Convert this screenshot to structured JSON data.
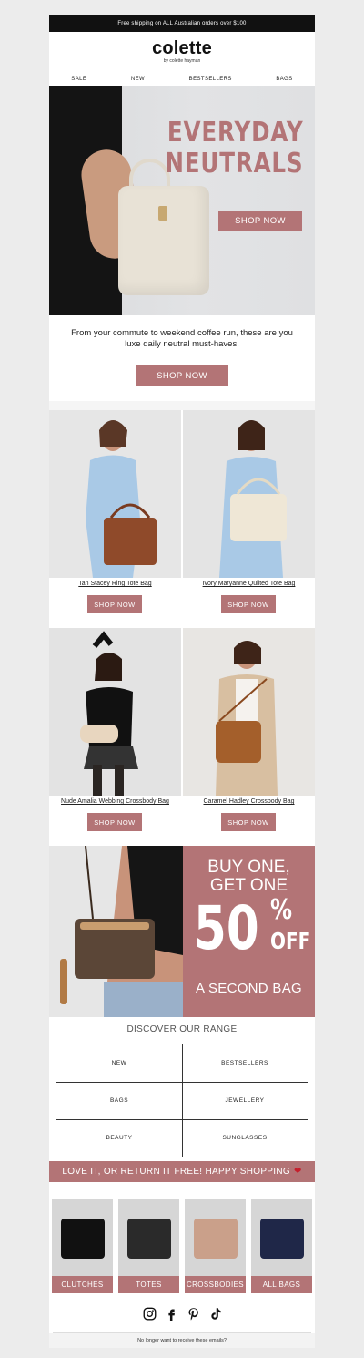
{
  "topbar": {
    "text": "Free shipping on ALL Australian orders over $100"
  },
  "brand": {
    "logo": "colette",
    "sub": "by colette hayman",
    "accent": "#b37476"
  },
  "nav": {
    "items": [
      "SALE",
      "NEW",
      "BESTSELLERS",
      "BAGS"
    ]
  },
  "hero": {
    "line1": "EVERYDAY",
    "line2": "NEUTRALS",
    "button": "SHOP NOW"
  },
  "intro": {
    "text": "From your commute to weekend coffee run, these are you luxe daily neutral must-haves.",
    "button": "SHOP NOW"
  },
  "products": [
    {
      "name": "Tan Stacey Ring Tote Bag",
      "button": "SHOP NOW"
    },
    {
      "name": "Ivory Maryanne Quilted Tote Bag",
      "button": "SHOP NOW"
    },
    {
      "name": "Nude Amalia Webbing Crossbody Bag",
      "button": "SHOP NOW"
    },
    {
      "name": "Caramel Hadley Crossbody Bag",
      "button": "SHOP NOW"
    }
  ],
  "promo": {
    "line1": "BUY ONE,",
    "line1b": "GET ONE",
    "big": "50",
    "pct": "%",
    "off": "OFF",
    "line3": "A SECOND BAG"
  },
  "discover": {
    "title": "DISCOVER OUR RANGE",
    "items": [
      "NEW",
      "BESTSELLERS",
      "BAGS",
      "JEWELLERY",
      "BEAUTY",
      "SUNGLASSES"
    ]
  },
  "love": {
    "text": "LOVE IT, OR RETURN IT FREE! HAPPY SHOPPING",
    "heart": "❤"
  },
  "categories": [
    "CLUTCHES",
    "TOTES",
    "CROSSBODIES",
    "ALL BAGS"
  ],
  "social": {
    "icons": [
      "instagram-icon",
      "facebook-icon",
      "pinterest-icon",
      "tiktok-icon"
    ]
  },
  "footer": {
    "text": "No longer want to receive these emails?"
  }
}
